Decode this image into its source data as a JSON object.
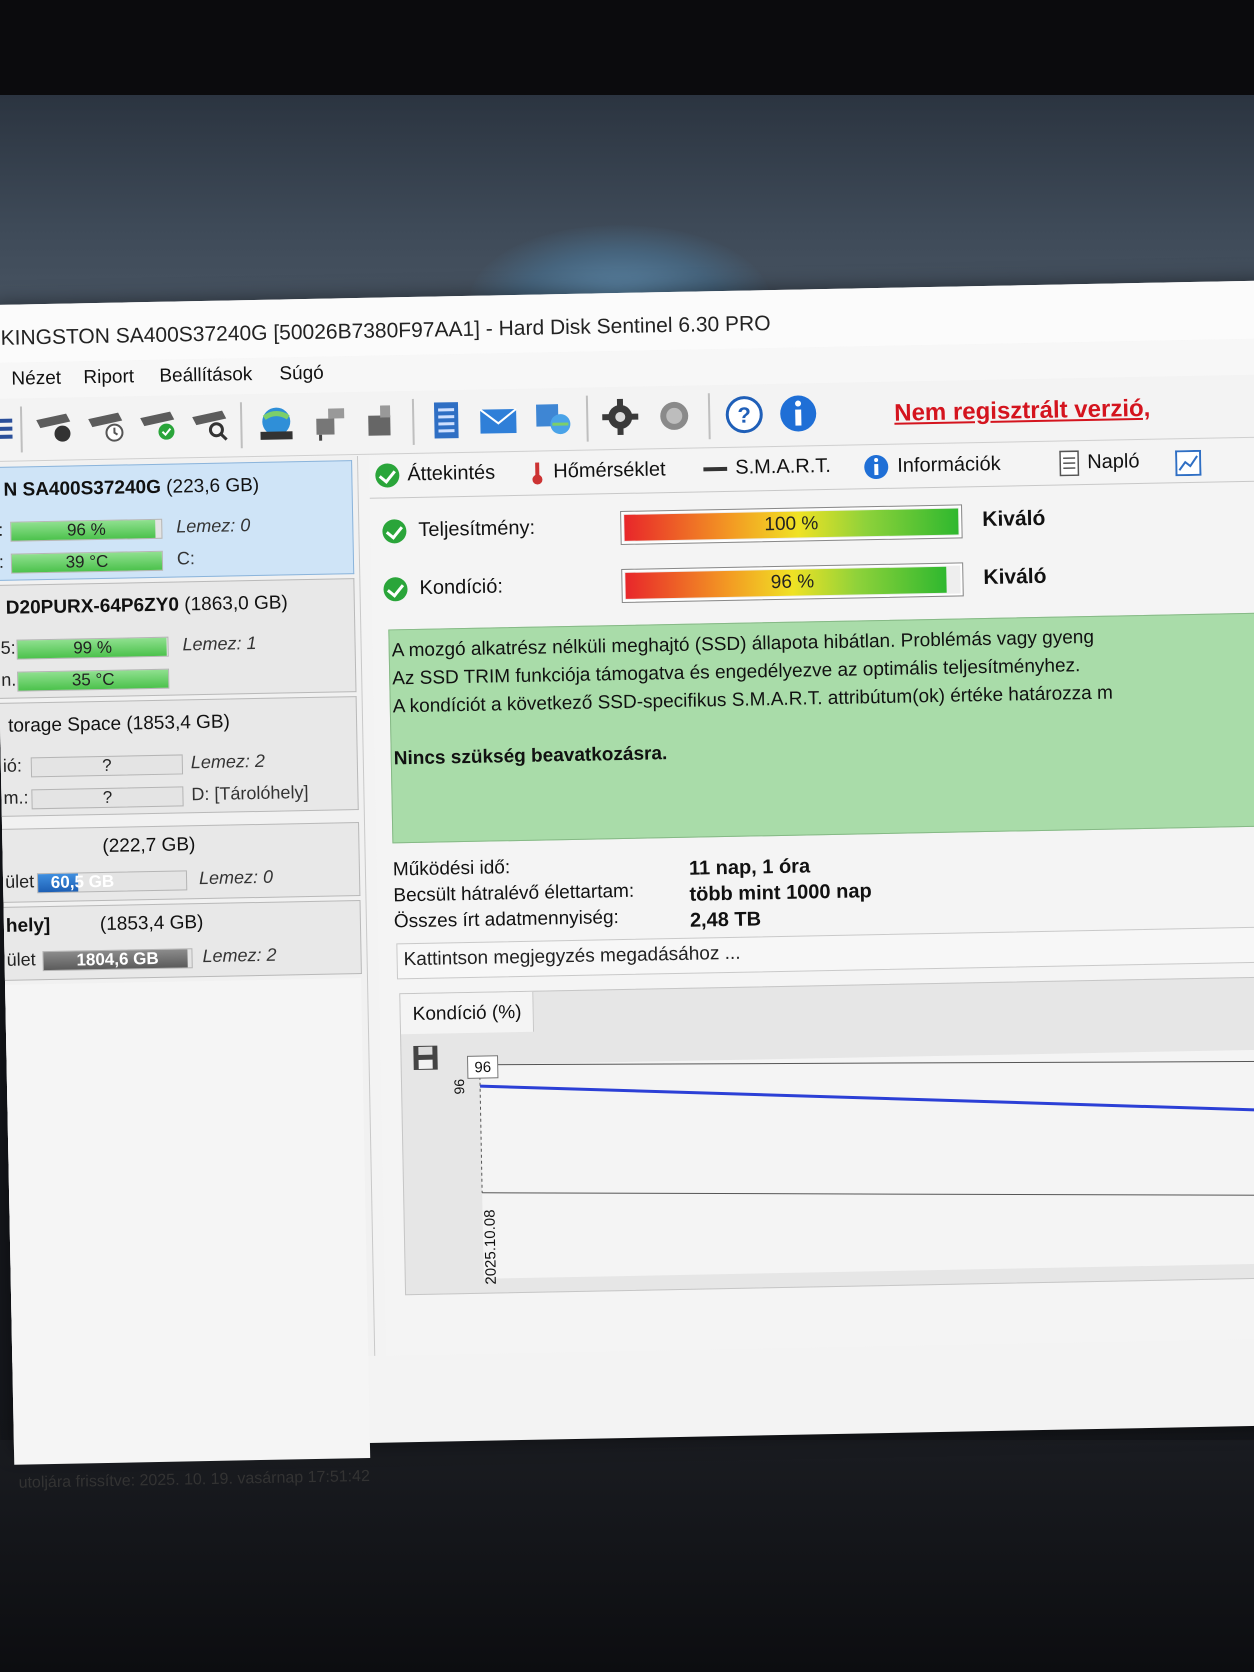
{
  "window": {
    "title": "KINGSTON SA400S37240G [50026B7380F97AA1]  -  Hard Disk Sentinel 6.30 PRO"
  },
  "menu": [
    "Nézet",
    "Riport",
    "Beállítások",
    "Súgó"
  ],
  "toolbar": {
    "unregistered": "Nem regisztrált verzió,"
  },
  "disks": [
    {
      "title_bold": "N SA400S37240G",
      "title_size": "(223,6 GB)",
      "row1_label": ":",
      "row1_value": "96 %",
      "row1_fill": 96,
      "row1_side": "Lemez: 0",
      "row2_label": ":",
      "row2_value": "39 °C",
      "row2_side": "C:"
    },
    {
      "title_bold": "D20PURX-64P6ZY0",
      "title_size": "(1863,0 GB)",
      "row1_label": "5:",
      "row1_value": "99 %",
      "row1_fill": 99,
      "row1_side": "Lemez: 1",
      "row2_label": "n.:",
      "row2_value": "35 °C",
      "row2_side": ""
    },
    {
      "title_bold": "",
      "title_size": "torage Space (1853,4 GB)",
      "row1_label": "ió:",
      "row1_value": "?",
      "row1_side": "Lemez: 2",
      "row2_label": "m.:",
      "row2_value": "?",
      "row2_side": "D: [Tárolóhely]"
    }
  ],
  "volumes": [
    {
      "title": "(222,7 GB)",
      "label": "ület",
      "value": "60,5 GB",
      "fill": 27,
      "side": "Lemez: 0"
    },
    {
      "title_left": "hely]",
      "title": "(1853,4 GB)",
      "label": "ület",
      "value": "1804,6 GB",
      "fill": 97,
      "side": "Lemez: 2"
    }
  ],
  "status_bar": "utoljára frissítve: 2025. 10. 19. vasárnap 17:51:42",
  "tabs": [
    "Áttekintés",
    "Hőmérséklet",
    "S.M.A.R.T.",
    "Információk",
    "Napló"
  ],
  "metrics": {
    "performance_label": "Teljesítmény:",
    "performance_value": "100 %",
    "performance_pct": 100,
    "performance_rating": "Kiváló",
    "condition_label": "Kondíció:",
    "condition_value": "96 %",
    "condition_pct": 96,
    "condition_rating": "Kiváló"
  },
  "status_text": {
    "line1": "A mozgó alkatrész nélküli meghajtó (SSD) állapota hibátlan. Problémás vagy gyeng",
    "line2": "Az SSD TRIM funkciója támogatva és engedélyezve az optimális teljesítményhez.",
    "line3": "A kondíciót a következő SSD-specifikus S.M.A.R.T. attribútum(ok) értéke határozza m",
    "action": "Nincs szükség beavatkozásra."
  },
  "info": {
    "uptime_label": "Működési idő:",
    "uptime_value": "11 nap, 1 óra",
    "lifetime_label": "Becsült hátralévő élettartam:",
    "lifetime_value": "több mint 1000 nap",
    "written_label": "Összes írt adatmennyiség:",
    "written_value": "2,48 TB"
  },
  "note_placeholder": "Kattintson megjegyzés megadásához ...",
  "chart_tab": "Kondíció  (%)",
  "chart_data": {
    "type": "line",
    "x": [
      "2025.10.08"
    ],
    "series": [
      {
        "values": [
          96
        ]
      }
    ],
    "y_tick_labels": [
      "96"
    ],
    "point_label": "96",
    "colors": {
      "line": "#2b3fd6"
    }
  }
}
